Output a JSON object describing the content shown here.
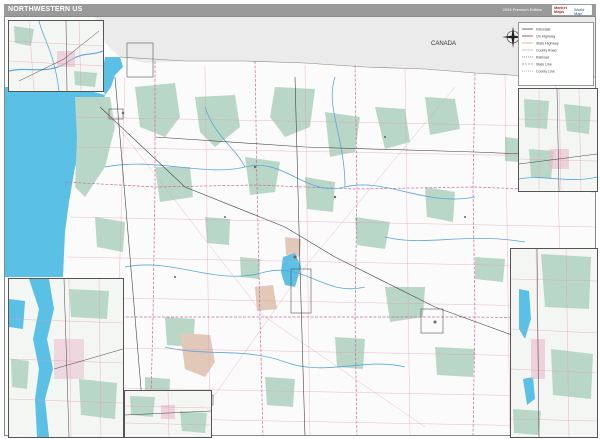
{
  "header": {
    "title": "NORTHWESTERN US",
    "edition": "2024 Premium Edition",
    "brand_line1": "Market",
    "brand_line2": "Maps",
    "brand_side": "World Map"
  },
  "map": {
    "country_label": "CANADA",
    "colors": {
      "water": "#5bc0e6",
      "land": "#fbfbfb",
      "canada": "#ebebeb",
      "forest": "#b9d7c6",
      "roads": "#e59ab3",
      "rivers": "#5aa7dd",
      "highways": "#444444",
      "reservation": "#e2c8b9",
      "titlebar": "#9a9a9a"
    }
  },
  "compass": {
    "north": "N",
    "south": "S",
    "east": "E",
    "west": "W"
  },
  "legend": {
    "items": [
      "Interstate",
      "US Highway",
      "State Highway",
      "County Road",
      "Railroad",
      "State Line",
      "County Line"
    ]
  },
  "insets": [
    "inset-top-left",
    "inset-right-upper",
    "inset-right-lower",
    "inset-bottom-left",
    "inset-bottom-small"
  ]
}
